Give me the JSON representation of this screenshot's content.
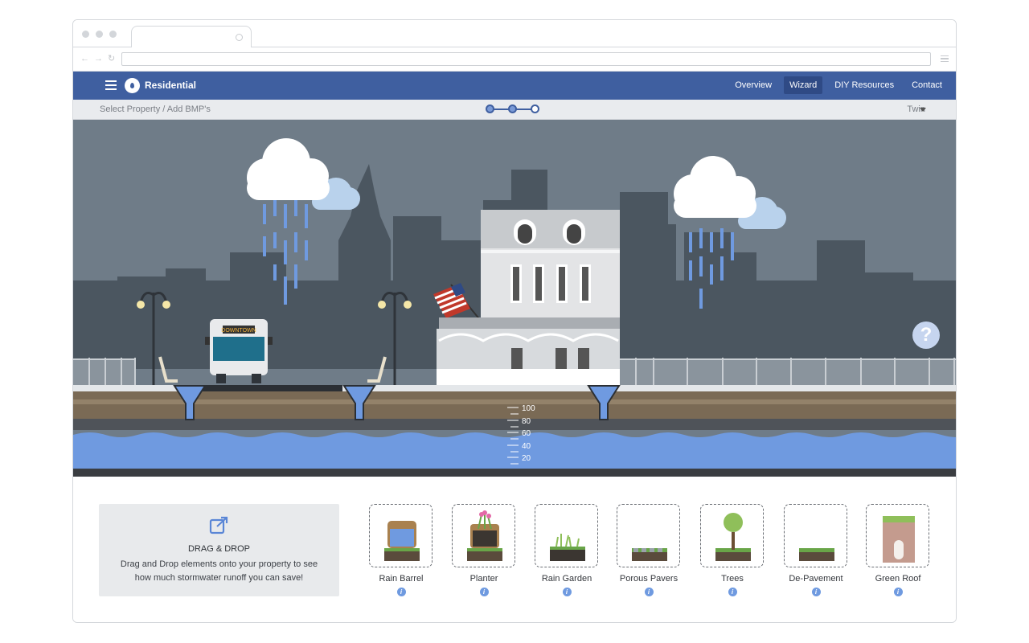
{
  "browser": {
    "tab_title": "",
    "address": ""
  },
  "app": {
    "title": "Residential"
  },
  "nav": {
    "items": [
      {
        "label": "Overview",
        "active": false
      },
      {
        "label": "Wizard",
        "active": true
      },
      {
        "label": "DIY Resources",
        "active": false
      },
      {
        "label": "Contact",
        "active": false
      }
    ]
  },
  "subbar": {
    "breadcrumb": "Select Property / Add BMP's",
    "steps": {
      "total": 3,
      "completed": 2
    },
    "property_select": "Twin"
  },
  "scene": {
    "bus_sign": "DOWNTOWN",
    "gauge_labels": [
      "100",
      "80",
      "60",
      "40",
      "20"
    ]
  },
  "drag_drop": {
    "title": "DRAG & DROP",
    "text": "Drag and Drop elements onto your property to see how much stormwater runoff you can save!"
  },
  "bmps": [
    {
      "label": "Rain Barrel",
      "icon": "rain-barrel-icon"
    },
    {
      "label": "Planter",
      "icon": "planter-icon"
    },
    {
      "label": "Rain Garden",
      "icon": "rain-garden-icon"
    },
    {
      "label": "Porous Pavers",
      "icon": "porous-pavers-icon"
    },
    {
      "label": "Trees",
      "icon": "tree-icon"
    },
    {
      "label": "De-Pavement",
      "icon": "de-pavement-icon"
    },
    {
      "label": "Green Roof",
      "icon": "green-roof-icon"
    }
  ],
  "colors": {
    "header": "#3f5fa0",
    "sky": "#6f7c88",
    "skyline": "#4b5660",
    "water": "#6f9ae0",
    "soil": "#7a6a55"
  }
}
